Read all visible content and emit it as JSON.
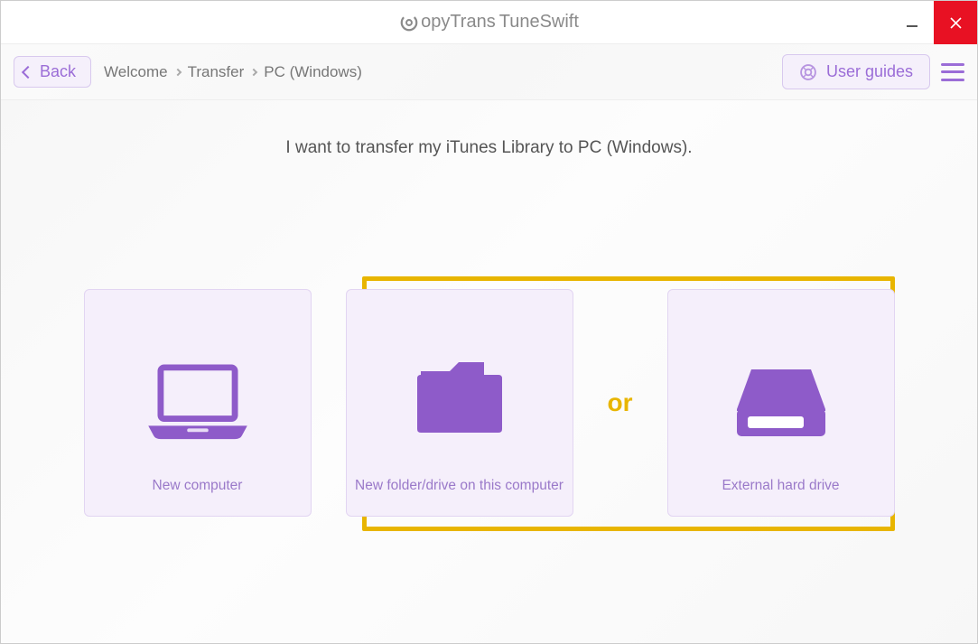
{
  "app": {
    "brand_first": "opyTrans",
    "brand_space": " ",
    "brand_second": "TuneSwift"
  },
  "toolbar": {
    "back_label": "Back",
    "guides_label": "User guides"
  },
  "breadcrumb": {
    "items": [
      "Welcome",
      "Transfer",
      "PC (Windows)"
    ]
  },
  "content": {
    "headline": "I want to transfer my iTunes Library to PC (Windows).",
    "or_label": "or",
    "options": {
      "new_computer": "New computer",
      "new_folder": "New folder/drive on this computer",
      "external_drive": "External hard drive"
    }
  },
  "colors": {
    "accent": "#9b6dd7",
    "highlight": "#e8b500",
    "card_bg": "#f5effb",
    "card_border": "#e2d5f2",
    "close_bg": "#e81123"
  }
}
